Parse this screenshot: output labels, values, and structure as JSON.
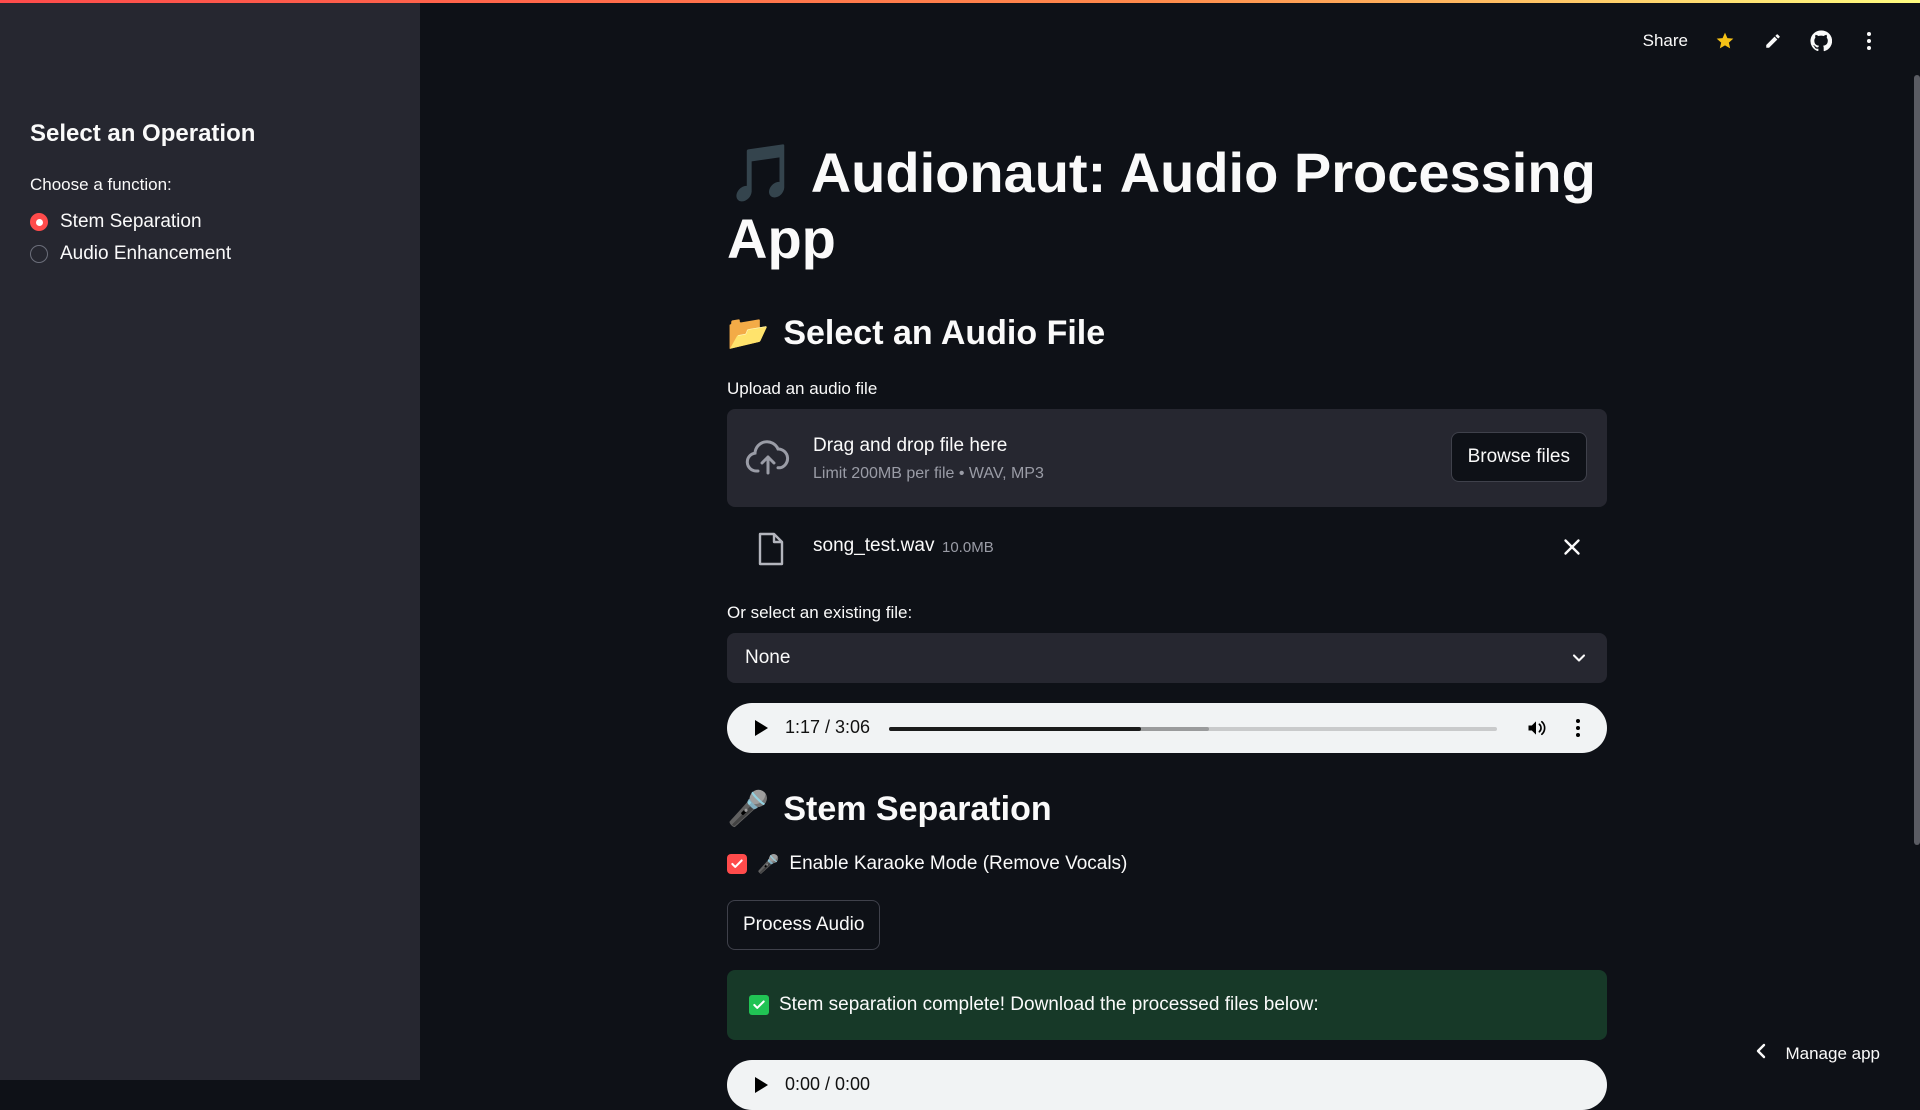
{
  "header": {
    "share_label": "Share",
    "icons": [
      "star-icon",
      "pencil-icon",
      "github-icon",
      "kebab-menu-icon"
    ],
    "accent": "#ff4b4b"
  },
  "sidebar": {
    "title": "Select an Operation",
    "radio_label": "Choose a function:",
    "options": [
      {
        "label": "Stem Separation",
        "selected": true
      },
      {
        "label": "Audio Enhancement",
        "selected": false
      }
    ]
  },
  "main": {
    "title_icon": "🎵",
    "title": "Audionaut: Audio Processing App",
    "select_section": {
      "icon": "📂",
      "heading": "Select an Audio File"
    },
    "uploader": {
      "label": "Upload an audio file",
      "drag_text": "Drag and drop file here",
      "limit_text": "Limit 200MB per file • WAV, MP3",
      "browse_label": "Browse files",
      "file": {
        "name": "song_test.wav",
        "size": "10.0MB"
      }
    },
    "existing": {
      "label": "Or select an existing file:",
      "value": "None"
    },
    "player_top": {
      "time": "1:17 / 3:06",
      "played_fraction": 0.415,
      "buffered_fraction": 0.527
    },
    "stem_section": {
      "icon": "🎤",
      "heading": "Stem Separation",
      "karaoke_icon": "🎤",
      "karaoke_label": "Enable Karaoke Mode (Remove Vocals)",
      "karaoke_checked": true,
      "process_label": "Process Audio",
      "success_text": "Stem separation complete! Download the processed files below:",
      "success_color": "#173928"
    },
    "player_bottom": {
      "time": "0:00 / 0:00"
    }
  },
  "footer": {
    "manage_label": "Manage app"
  }
}
